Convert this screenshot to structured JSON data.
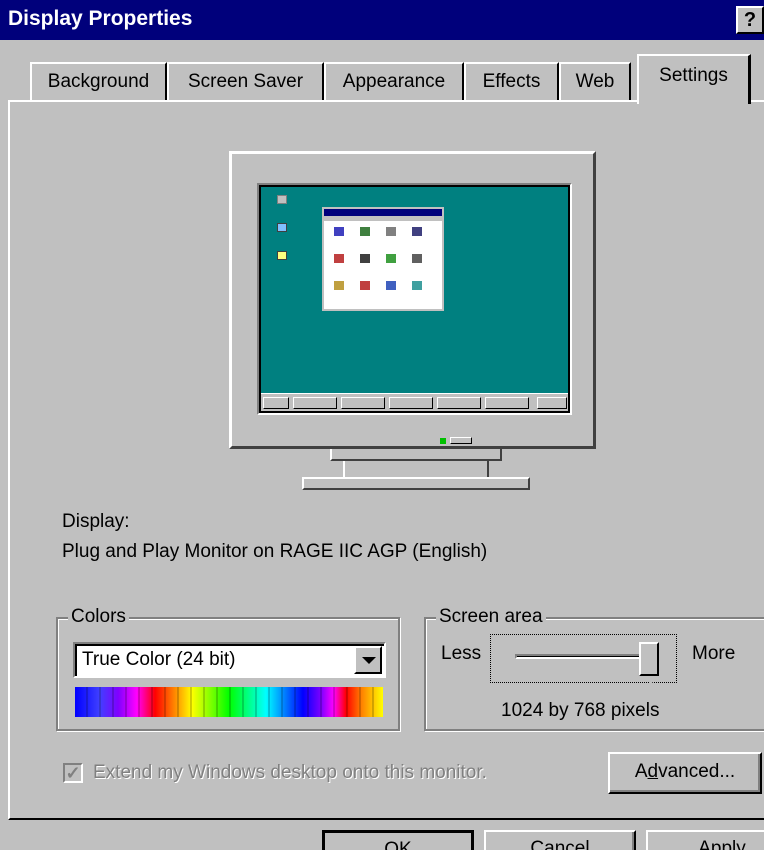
{
  "window": {
    "title": "Display Properties",
    "help_label": "?"
  },
  "tabs": [
    {
      "label": "Background"
    },
    {
      "label": "Screen Saver"
    },
    {
      "label": "Appearance"
    },
    {
      "label": "Effects"
    },
    {
      "label": "Web"
    },
    {
      "label": "Settings"
    }
  ],
  "display": {
    "label": "Display:",
    "device": "Plug and Play Monitor on RAGE IIC AGP (English)"
  },
  "colors": {
    "group_title": "Colors",
    "selected": "True Color (24 bit)"
  },
  "screen_area": {
    "group_title": "Screen area",
    "less_label": "Less",
    "more_label": "More",
    "resolution": "1024 by 768 pixels",
    "slider_value": 1.0
  },
  "extend_desktop": {
    "label": "Extend my Windows desktop onto this monitor.",
    "checked": true,
    "enabled": false
  },
  "buttons": {
    "advanced": "Advanced...",
    "ok": "OK",
    "cancel": "Cancel",
    "apply": "Apply"
  },
  "theme": {
    "titlebar": "#00007b",
    "face": "#c0c0c0",
    "desktop": "#008080"
  }
}
